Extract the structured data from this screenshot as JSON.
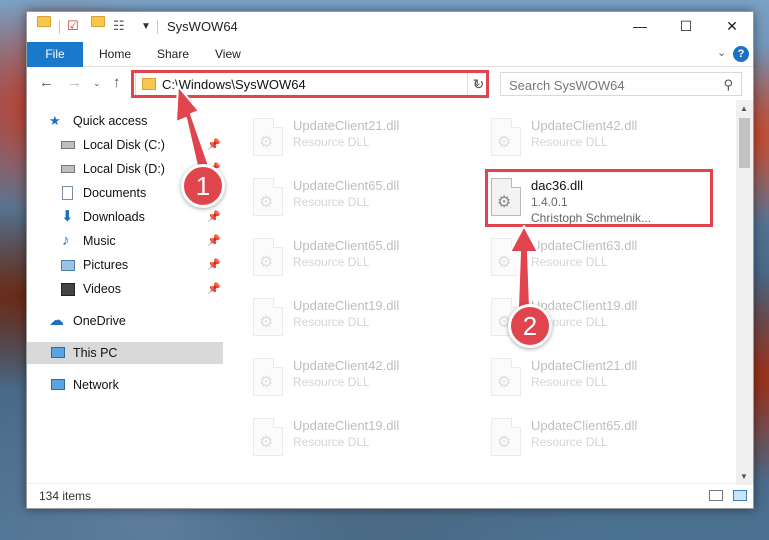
{
  "window": {
    "title": "SysWOW64",
    "controls": {
      "minimize": "—",
      "maximize": "☐",
      "close": "✕"
    }
  },
  "ribbon": {
    "tabs": [
      "File",
      "Home",
      "Share",
      "View"
    ],
    "help": "?"
  },
  "address": {
    "path": "C:\\Windows\\SysWOW64",
    "search_placeholder": "Search SysWOW64"
  },
  "sidebar": {
    "quick_access": "Quick access",
    "items": [
      {
        "label": "Local Disk (C:)",
        "pinned": true
      },
      {
        "label": "Local Disk (D:)",
        "pinned": true
      },
      {
        "label": "Documents",
        "pinned": true
      },
      {
        "label": "Downloads",
        "pinned": true
      },
      {
        "label": "Music",
        "pinned": true
      },
      {
        "label": "Pictures",
        "pinned": true
      },
      {
        "label": "Videos",
        "pinned": true
      }
    ],
    "onedrive": "OneDrive",
    "this_pc": "This PC",
    "network": "Network"
  },
  "files": {
    "left": [
      {
        "name": "UpdateClient21.dll",
        "type": "Resource DLL"
      },
      {
        "name": "UpdateClient65.dll",
        "type": "Resource DLL"
      },
      {
        "name": "UpdateClient65.dll",
        "type": "Resource DLL"
      },
      {
        "name": "UpdateClient19.dll",
        "type": "Resource DLL"
      },
      {
        "name": "UpdateClient42.dll",
        "type": "Resource DLL"
      },
      {
        "name": "UpdateClient19.dll",
        "type": "Resource DLL"
      }
    ],
    "right": [
      {
        "name": "UpdateClient42.dll",
        "type": "Resource DLL"
      },
      {
        "name": "dac36.dll",
        "version": "1.4.0.1",
        "company": "Christoph Schmelnik..."
      },
      {
        "name": "UpdateClient63.dll",
        "type": "Resource DLL"
      },
      {
        "name": "UpdateClient19.dll",
        "type": "Resource DLL"
      },
      {
        "name": "UpdateClient21.dll",
        "type": "Resource DLL"
      },
      {
        "name": "UpdateClient65.dll",
        "type": "Resource DLL"
      }
    ]
  },
  "status": {
    "item_count": "134 items"
  },
  "callouts": {
    "one": "1",
    "two": "2",
    "color": "#e0454d"
  }
}
